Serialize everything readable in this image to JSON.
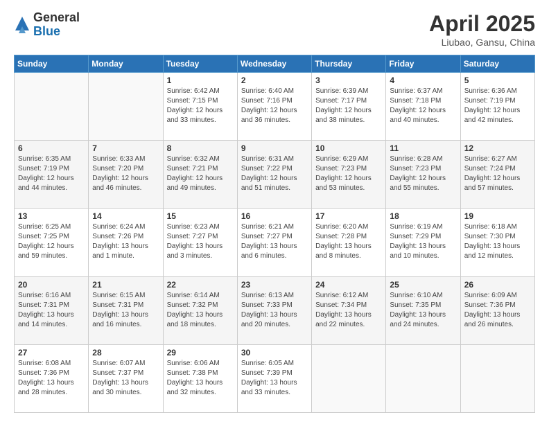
{
  "logo": {
    "general": "General",
    "blue": "Blue"
  },
  "header": {
    "month": "April 2025",
    "location": "Liubao, Gansu, China"
  },
  "days_of_week": [
    "Sunday",
    "Monday",
    "Tuesday",
    "Wednesday",
    "Thursday",
    "Friday",
    "Saturday"
  ],
  "weeks": [
    [
      {
        "day": "",
        "info": ""
      },
      {
        "day": "",
        "info": ""
      },
      {
        "day": "1",
        "info": "Sunrise: 6:42 AM\nSunset: 7:15 PM\nDaylight: 12 hours\nand 33 minutes."
      },
      {
        "day": "2",
        "info": "Sunrise: 6:40 AM\nSunset: 7:16 PM\nDaylight: 12 hours\nand 36 minutes."
      },
      {
        "day": "3",
        "info": "Sunrise: 6:39 AM\nSunset: 7:17 PM\nDaylight: 12 hours\nand 38 minutes."
      },
      {
        "day": "4",
        "info": "Sunrise: 6:37 AM\nSunset: 7:18 PM\nDaylight: 12 hours\nand 40 minutes."
      },
      {
        "day": "5",
        "info": "Sunrise: 6:36 AM\nSunset: 7:19 PM\nDaylight: 12 hours\nand 42 minutes."
      }
    ],
    [
      {
        "day": "6",
        "info": "Sunrise: 6:35 AM\nSunset: 7:19 PM\nDaylight: 12 hours\nand 44 minutes."
      },
      {
        "day": "7",
        "info": "Sunrise: 6:33 AM\nSunset: 7:20 PM\nDaylight: 12 hours\nand 46 minutes."
      },
      {
        "day": "8",
        "info": "Sunrise: 6:32 AM\nSunset: 7:21 PM\nDaylight: 12 hours\nand 49 minutes."
      },
      {
        "day": "9",
        "info": "Sunrise: 6:31 AM\nSunset: 7:22 PM\nDaylight: 12 hours\nand 51 minutes."
      },
      {
        "day": "10",
        "info": "Sunrise: 6:29 AM\nSunset: 7:23 PM\nDaylight: 12 hours\nand 53 minutes."
      },
      {
        "day": "11",
        "info": "Sunrise: 6:28 AM\nSunset: 7:23 PM\nDaylight: 12 hours\nand 55 minutes."
      },
      {
        "day": "12",
        "info": "Sunrise: 6:27 AM\nSunset: 7:24 PM\nDaylight: 12 hours\nand 57 minutes."
      }
    ],
    [
      {
        "day": "13",
        "info": "Sunrise: 6:25 AM\nSunset: 7:25 PM\nDaylight: 12 hours\nand 59 minutes."
      },
      {
        "day": "14",
        "info": "Sunrise: 6:24 AM\nSunset: 7:26 PM\nDaylight: 13 hours\nand 1 minute."
      },
      {
        "day": "15",
        "info": "Sunrise: 6:23 AM\nSunset: 7:27 PM\nDaylight: 13 hours\nand 3 minutes."
      },
      {
        "day": "16",
        "info": "Sunrise: 6:21 AM\nSunset: 7:27 PM\nDaylight: 13 hours\nand 6 minutes."
      },
      {
        "day": "17",
        "info": "Sunrise: 6:20 AM\nSunset: 7:28 PM\nDaylight: 13 hours\nand 8 minutes."
      },
      {
        "day": "18",
        "info": "Sunrise: 6:19 AM\nSunset: 7:29 PM\nDaylight: 13 hours\nand 10 minutes."
      },
      {
        "day": "19",
        "info": "Sunrise: 6:18 AM\nSunset: 7:30 PM\nDaylight: 13 hours\nand 12 minutes."
      }
    ],
    [
      {
        "day": "20",
        "info": "Sunrise: 6:16 AM\nSunset: 7:31 PM\nDaylight: 13 hours\nand 14 minutes."
      },
      {
        "day": "21",
        "info": "Sunrise: 6:15 AM\nSunset: 7:31 PM\nDaylight: 13 hours\nand 16 minutes."
      },
      {
        "day": "22",
        "info": "Sunrise: 6:14 AM\nSunset: 7:32 PM\nDaylight: 13 hours\nand 18 minutes."
      },
      {
        "day": "23",
        "info": "Sunrise: 6:13 AM\nSunset: 7:33 PM\nDaylight: 13 hours\nand 20 minutes."
      },
      {
        "day": "24",
        "info": "Sunrise: 6:12 AM\nSunset: 7:34 PM\nDaylight: 13 hours\nand 22 minutes."
      },
      {
        "day": "25",
        "info": "Sunrise: 6:10 AM\nSunset: 7:35 PM\nDaylight: 13 hours\nand 24 minutes."
      },
      {
        "day": "26",
        "info": "Sunrise: 6:09 AM\nSunset: 7:36 PM\nDaylight: 13 hours\nand 26 minutes."
      }
    ],
    [
      {
        "day": "27",
        "info": "Sunrise: 6:08 AM\nSunset: 7:36 PM\nDaylight: 13 hours\nand 28 minutes."
      },
      {
        "day": "28",
        "info": "Sunrise: 6:07 AM\nSunset: 7:37 PM\nDaylight: 13 hours\nand 30 minutes."
      },
      {
        "day": "29",
        "info": "Sunrise: 6:06 AM\nSunset: 7:38 PM\nDaylight: 13 hours\nand 32 minutes."
      },
      {
        "day": "30",
        "info": "Sunrise: 6:05 AM\nSunset: 7:39 PM\nDaylight: 13 hours\nand 33 minutes."
      },
      {
        "day": "",
        "info": ""
      },
      {
        "day": "",
        "info": ""
      },
      {
        "day": "",
        "info": ""
      }
    ]
  ]
}
